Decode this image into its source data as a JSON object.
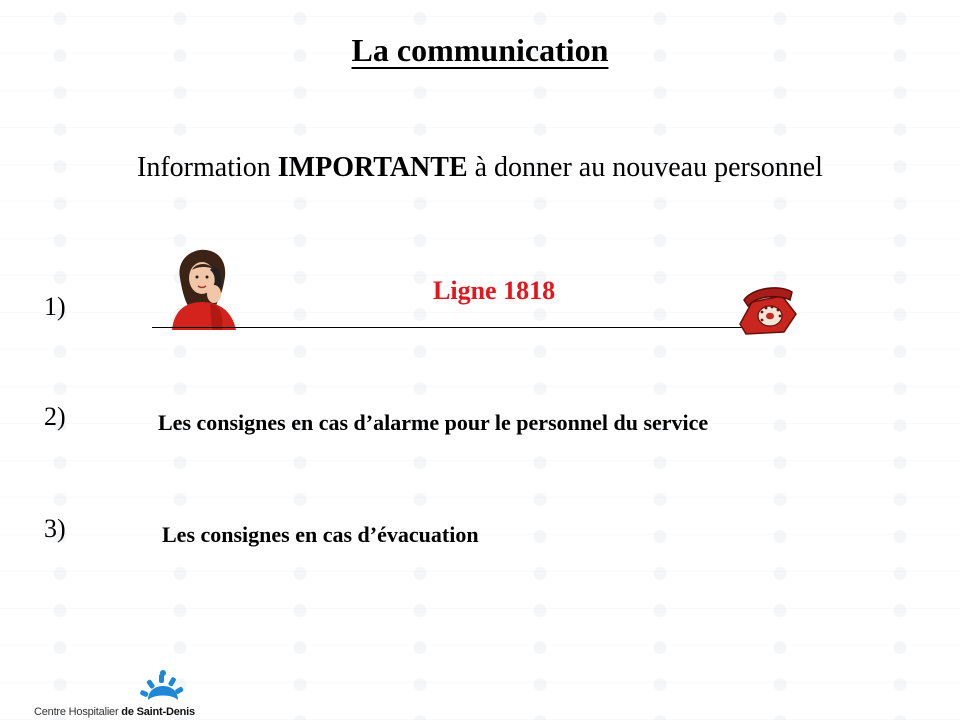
{
  "title": "La communication",
  "subtitle": {
    "before": "Information ",
    "strong": "IMPORTANTE",
    "after": " à donner au nouveau personnel"
  },
  "items": [
    {
      "number": "1)",
      "label": "Ligne 1818"
    },
    {
      "number": "2)",
      "label": "Les consignes en cas d’alarme pour le personnel du service"
    },
    {
      "number": "3)",
      "label": "Les consignes en cas d’évacuation"
    }
  ],
  "logo": {
    "prefix": "Centre Hospitalier ",
    "name": "de Saint-Denis",
    "color": "#1e88d6"
  },
  "icons": {
    "person": "woman-on-phone-icon",
    "phone": "red-telephone-icon",
    "logo": "sun-logo-icon"
  },
  "colors": {
    "ligne": "#e3161b",
    "phone": "#c8261f"
  }
}
